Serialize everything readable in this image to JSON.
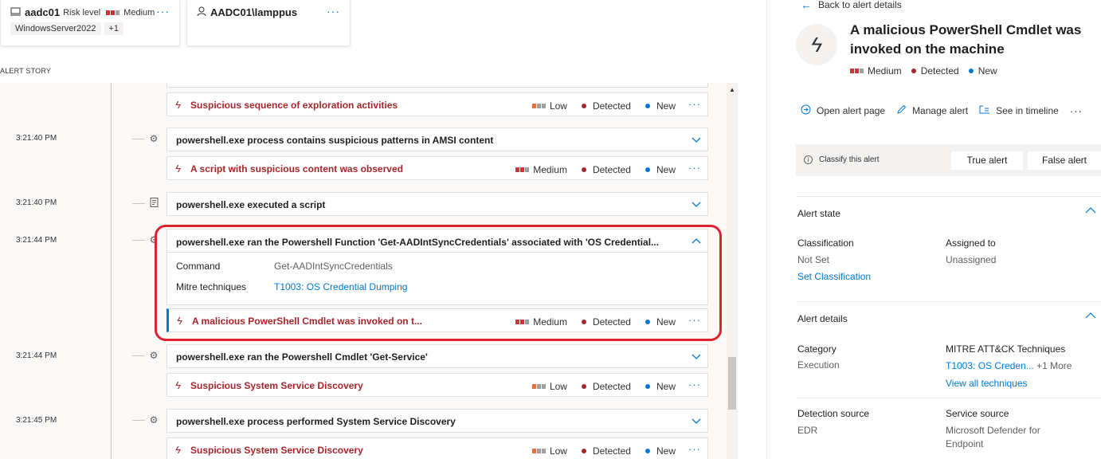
{
  "device_card": {
    "name": "aadc01",
    "risk_label": "Risk level",
    "risk_value": "Medium",
    "tags": [
      "WindowsServer2022",
      "+1"
    ],
    "more": "···"
  },
  "user_card": {
    "name": "AADC01\\lamppus",
    "more": "···"
  },
  "story_label": "ALERT STORY",
  "timeline": {
    "top_alert": {
      "title": "Suspicious sequence of exploration activities",
      "severity": "Low",
      "status": "Detected",
      "state": "New"
    },
    "events": [
      {
        "time": "3:21:40 PM",
        "title": "powershell.exe process contains suspicious patterns in AMSI content",
        "alert": {
          "title": "A script with suspicious content was observed",
          "severity": "Medium",
          "status": "Detected",
          "state": "New"
        }
      },
      {
        "time": "3:21:40 PM",
        "title": "powershell.exe executed a script"
      },
      {
        "time": "3:21:44 PM",
        "title": "powershell.exe ran the Powershell Function 'Get-AADIntSyncCredentials' associated with 'OS Credential...",
        "details": [
          {
            "key": "Command",
            "value": "Get-AADIntSyncCredentials"
          },
          {
            "key": "Mitre techniques",
            "value": "T1003: OS Credential Dumping"
          }
        ],
        "alert": {
          "title": "A malicious PowerShell Cmdlet was invoked on t...",
          "severity": "Medium",
          "status": "Detected",
          "state": "New"
        }
      },
      {
        "time": "3:21:44 PM",
        "title": "powershell.exe ran the Powershell Cmdlet 'Get-Service'",
        "alert": {
          "title": "Suspicious System Service Discovery",
          "severity": "Low",
          "status": "Detected",
          "state": "New"
        }
      },
      {
        "time": "3:21:45 PM",
        "title": "powershell.exe process performed System Service Discovery",
        "alert": {
          "title": "Suspicious System Service Discovery",
          "severity": "Low",
          "status": "Detected",
          "state": "New"
        }
      }
    ]
  },
  "pane": {
    "back": "Back to alert details",
    "title": "A malicious PowerShell Cmdlet was invoked on the machine",
    "severity": "Medium",
    "status": "Detected",
    "state": "New",
    "actions": [
      "Open alert page",
      "Manage alert",
      "See in timeline"
    ],
    "more": "···",
    "classify_label": "Classify this alert",
    "true_alert": "True alert",
    "false_alert": "False alert",
    "alert_state": {
      "title": "Alert state",
      "classification_label": "Classification",
      "classification_value": "Not Set",
      "set_classification": "Set Classification",
      "assigned_label": "Assigned to",
      "assigned_value": "Unassigned"
    },
    "alert_details": {
      "title": "Alert details",
      "category_label": "Category",
      "category_value": "Execution",
      "mitre_label": "MITRE ATT&CK Techniques",
      "mitre_value": "T1003: OS Creden...",
      "mitre_more": "+1 More",
      "view_all": "View all techniques",
      "detection_label": "Detection source",
      "detection_value": "EDR",
      "service_label": "Service source",
      "service_value": "Microsoft Defender for Endpoint"
    }
  },
  "colors": {
    "accent": "#0078d4",
    "alert_red": "#a4262c",
    "highlight": "#e0202e"
  }
}
